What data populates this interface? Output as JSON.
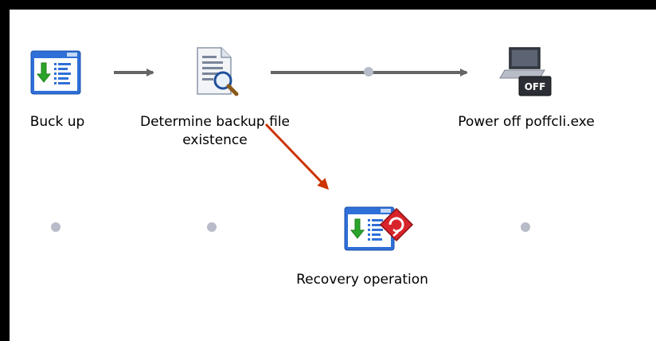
{
  "diagram": {
    "nodes": [
      {
        "id": "backup",
        "label": "Buck up",
        "icon": "job-download-icon"
      },
      {
        "id": "determine",
        "label_line1": "Determine backup file",
        "label_line2": "existence",
        "icon": "document-search-icon"
      },
      {
        "id": "poweroff",
        "label": "Power off poffcli.exe",
        "icon": "power-off-computer-icon"
      },
      {
        "id": "recovery",
        "label": "Recovery operation",
        "icon": "job-recovery-icon"
      }
    ],
    "edges": [
      {
        "from": "backup",
        "to": "determine",
        "color": "#666666"
      },
      {
        "from": "determine",
        "to": "poweroff",
        "color": "#666666"
      },
      {
        "from": "determine",
        "to": "recovery",
        "color": "#cc3300"
      }
    ],
    "icon_badge_text": "OFF",
    "colors": {
      "connector": "#666666",
      "highlight_arrow": "#cc3300",
      "empty_slot": "#b8bcc8",
      "frame": "#000000"
    }
  }
}
